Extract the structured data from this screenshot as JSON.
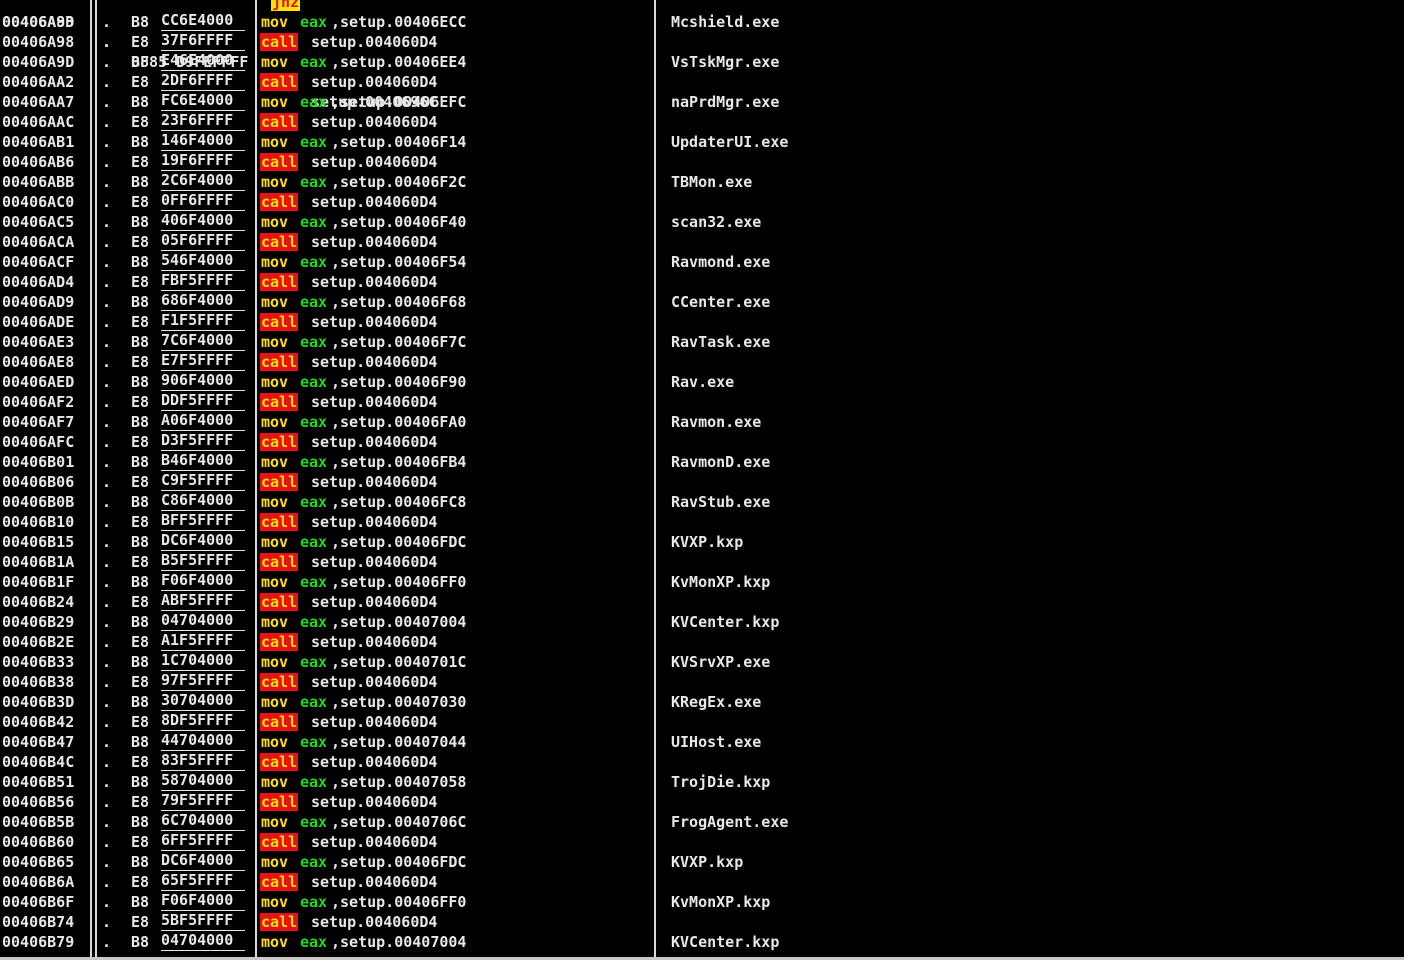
{
  "colors": {
    "background": "#000000",
    "text": "#e8e8e8",
    "call_bg": "#e8101a",
    "call_fg": "#ffe000",
    "mov_fg": "#ffe000",
    "register": "#20d820",
    "jump_bg": "#ffe000",
    "jump_fg": "#e8101a"
  },
  "top_partial_row": {
    "address": "00406A8D",
    "marker": ".",
    "opcode": "0F85 D9FEFFFF",
    "mnemonic": "jnz",
    "operand": "setup.0040696C"
  },
  "rows": [
    {
      "address": "00406A93",
      "marker": ".",
      "opcode": "B8",
      "imm": "CC6E4000",
      "mnemonic": "mov",
      "reg": "eax",
      "operand": ",setup.00406ECC",
      "comment": "Mcshield.exe"
    },
    {
      "address": "00406A98",
      "marker": ".",
      "opcode": "E8",
      "imm": "37F6FFFF",
      "mnemonic": "call",
      "operand": "setup.004060D4"
    },
    {
      "address": "00406A9D",
      "marker": ".",
      "opcode": "B8",
      "imm": "E46E4000",
      "mnemonic": "mov",
      "reg": "eax",
      "operand": ",setup.00406EE4",
      "comment": "VsTskMgr.exe"
    },
    {
      "address": "00406AA2",
      "marker": ".",
      "opcode": "E8",
      "imm": "2DF6FFFF",
      "mnemonic": "call",
      "operand": "setup.004060D4"
    },
    {
      "address": "00406AA7",
      "marker": ".",
      "opcode": "B8",
      "imm": "FC6E4000",
      "mnemonic": "mov",
      "reg": "eax",
      "operand": ",setup.00406EFC",
      "comment": "naPrdMgr.exe"
    },
    {
      "address": "00406AAC",
      "marker": ".",
      "opcode": "E8",
      "imm": "23F6FFFF",
      "mnemonic": "call",
      "operand": "setup.004060D4"
    },
    {
      "address": "00406AB1",
      "marker": ".",
      "opcode": "B8",
      "imm": "146F4000",
      "mnemonic": "mov",
      "reg": "eax",
      "operand": ",setup.00406F14",
      "comment": "UpdaterUI.exe"
    },
    {
      "address": "00406AB6",
      "marker": ".",
      "opcode": "E8",
      "imm": "19F6FFFF",
      "mnemonic": "call",
      "operand": "setup.004060D4"
    },
    {
      "address": "00406ABB",
      "marker": ".",
      "opcode": "B8",
      "imm": "2C6F4000",
      "mnemonic": "mov",
      "reg": "eax",
      "operand": ",setup.00406F2C",
      "comment": "TBMon.exe"
    },
    {
      "address": "00406AC0",
      "marker": ".",
      "opcode": "E8",
      "imm": "0FF6FFFF",
      "mnemonic": "call",
      "operand": "setup.004060D4"
    },
    {
      "address": "00406AC5",
      "marker": ".",
      "opcode": "B8",
      "imm": "406F4000",
      "mnemonic": "mov",
      "reg": "eax",
      "operand": ",setup.00406F40",
      "comment": "scan32.exe"
    },
    {
      "address": "00406ACA",
      "marker": ".",
      "opcode": "E8",
      "imm": "05F6FFFF",
      "mnemonic": "call",
      "operand": "setup.004060D4"
    },
    {
      "address": "00406ACF",
      "marker": ".",
      "opcode": "B8",
      "imm": "546F4000",
      "mnemonic": "mov",
      "reg": "eax",
      "operand": ",setup.00406F54",
      "comment": "Ravmond.exe"
    },
    {
      "address": "00406AD4",
      "marker": ".",
      "opcode": "E8",
      "imm": "FBF5FFFF",
      "mnemonic": "call",
      "operand": "setup.004060D4"
    },
    {
      "address": "00406AD9",
      "marker": ".",
      "opcode": "B8",
      "imm": "686F4000",
      "mnemonic": "mov",
      "reg": "eax",
      "operand": ",setup.00406F68",
      "comment": "CCenter.exe"
    },
    {
      "address": "00406ADE",
      "marker": ".",
      "opcode": "E8",
      "imm": "F1F5FFFF",
      "mnemonic": "call",
      "operand": "setup.004060D4"
    },
    {
      "address": "00406AE3",
      "marker": ".",
      "opcode": "B8",
      "imm": "7C6F4000",
      "mnemonic": "mov",
      "reg": "eax",
      "operand": ",setup.00406F7C",
      "comment": "RavTask.exe"
    },
    {
      "address": "00406AE8",
      "marker": ".",
      "opcode": "E8",
      "imm": "E7F5FFFF",
      "mnemonic": "call",
      "operand": "setup.004060D4"
    },
    {
      "address": "00406AED",
      "marker": ".",
      "opcode": "B8",
      "imm": "906F4000",
      "mnemonic": "mov",
      "reg": "eax",
      "operand": ",setup.00406F90",
      "comment": "Rav.exe"
    },
    {
      "address": "00406AF2",
      "marker": ".",
      "opcode": "E8",
      "imm": "DDF5FFFF",
      "mnemonic": "call",
      "operand": "setup.004060D4"
    },
    {
      "address": "00406AF7",
      "marker": ".",
      "opcode": "B8",
      "imm": "A06F4000",
      "mnemonic": "mov",
      "reg": "eax",
      "operand": ",setup.00406FA0",
      "comment": "Ravmon.exe"
    },
    {
      "address": "00406AFC",
      "marker": ".",
      "opcode": "E8",
      "imm": "D3F5FFFF",
      "mnemonic": "call",
      "operand": "setup.004060D4"
    },
    {
      "address": "00406B01",
      "marker": ".",
      "opcode": "B8",
      "imm": "B46F4000",
      "mnemonic": "mov",
      "reg": "eax",
      "operand": ",setup.00406FB4",
      "comment": "RavmonD.exe"
    },
    {
      "address": "00406B06",
      "marker": ".",
      "opcode": "E8",
      "imm": "C9F5FFFF",
      "mnemonic": "call",
      "operand": "setup.004060D4"
    },
    {
      "address": "00406B0B",
      "marker": ".",
      "opcode": "B8",
      "imm": "C86F4000",
      "mnemonic": "mov",
      "reg": "eax",
      "operand": ",setup.00406FC8",
      "comment": "RavStub.exe"
    },
    {
      "address": "00406B10",
      "marker": ".",
      "opcode": "E8",
      "imm": "BFF5FFFF",
      "mnemonic": "call",
      "operand": "setup.004060D4"
    },
    {
      "address": "00406B15",
      "marker": ".",
      "opcode": "B8",
      "imm": "DC6F4000",
      "mnemonic": "mov",
      "reg": "eax",
      "operand": ",setup.00406FDC",
      "comment": "KVXP.kxp"
    },
    {
      "address": "00406B1A",
      "marker": ".",
      "opcode": "E8",
      "imm": "B5F5FFFF",
      "mnemonic": "call",
      "operand": "setup.004060D4"
    },
    {
      "address": "00406B1F",
      "marker": ".",
      "opcode": "B8",
      "imm": "F06F4000",
      "mnemonic": "mov",
      "reg": "eax",
      "operand": ",setup.00406FF0",
      "comment": "KvMonXP.kxp"
    },
    {
      "address": "00406B24",
      "marker": ".",
      "opcode": "E8",
      "imm": "ABF5FFFF",
      "mnemonic": "call",
      "operand": "setup.004060D4"
    },
    {
      "address": "00406B29",
      "marker": ".",
      "opcode": "B8",
      "imm": "04704000",
      "mnemonic": "mov",
      "reg": "eax",
      "operand": ",setup.00407004",
      "comment": "KVCenter.kxp"
    },
    {
      "address": "00406B2E",
      "marker": ".",
      "opcode": "E8",
      "imm": "A1F5FFFF",
      "mnemonic": "call",
      "operand": "setup.004060D4"
    },
    {
      "address": "00406B33",
      "marker": ".",
      "opcode": "B8",
      "imm": "1C704000",
      "mnemonic": "mov",
      "reg": "eax",
      "operand": ",setup.0040701C",
      "comment": "KVSrvXP.exe"
    },
    {
      "address": "00406B38",
      "marker": ".",
      "opcode": "E8",
      "imm": "97F5FFFF",
      "mnemonic": "call",
      "operand": "setup.004060D4"
    },
    {
      "address": "00406B3D",
      "marker": ".",
      "opcode": "B8",
      "imm": "30704000",
      "mnemonic": "mov",
      "reg": "eax",
      "operand": ",setup.00407030",
      "comment": "KRegEx.exe"
    },
    {
      "address": "00406B42",
      "marker": ".",
      "opcode": "E8",
      "imm": "8DF5FFFF",
      "mnemonic": "call",
      "operand": "setup.004060D4"
    },
    {
      "address": "00406B47",
      "marker": ".",
      "opcode": "B8",
      "imm": "44704000",
      "mnemonic": "mov",
      "reg": "eax",
      "operand": ",setup.00407044",
      "comment": "UIHost.exe"
    },
    {
      "address": "00406B4C",
      "marker": ".",
      "opcode": "E8",
      "imm": "83F5FFFF",
      "mnemonic": "call",
      "operand": "setup.004060D4"
    },
    {
      "address": "00406B51",
      "marker": ".",
      "opcode": "B8",
      "imm": "58704000",
      "mnemonic": "mov",
      "reg": "eax",
      "operand": ",setup.00407058",
      "comment": "TrojDie.kxp"
    },
    {
      "address": "00406B56",
      "marker": ".",
      "opcode": "E8",
      "imm": "79F5FFFF",
      "mnemonic": "call",
      "operand": "setup.004060D4"
    },
    {
      "address": "00406B5B",
      "marker": ".",
      "opcode": "B8",
      "imm": "6C704000",
      "mnemonic": "mov",
      "reg": "eax",
      "operand": ",setup.0040706C",
      "comment": "FrogAgent.exe"
    },
    {
      "address": "00406B60",
      "marker": ".",
      "opcode": "E8",
      "imm": "6FF5FFFF",
      "mnemonic": "call",
      "operand": "setup.004060D4"
    },
    {
      "address": "00406B65",
      "marker": ".",
      "opcode": "B8",
      "imm": "DC6F4000",
      "mnemonic": "mov",
      "reg": "eax",
      "operand": ",setup.00406FDC",
      "comment": "KVXP.kxp"
    },
    {
      "address": "00406B6A",
      "marker": ".",
      "opcode": "E8",
      "imm": "65F5FFFF",
      "mnemonic": "call",
      "operand": "setup.004060D4"
    },
    {
      "address": "00406B6F",
      "marker": ".",
      "opcode": "B8",
      "imm": "F06F4000",
      "mnemonic": "mov",
      "reg": "eax",
      "operand": ",setup.00406FF0",
      "comment": "KvMonXP.kxp"
    },
    {
      "address": "00406B74",
      "marker": ".",
      "opcode": "E8",
      "imm": "5BF5FFFF",
      "mnemonic": "call",
      "operand": "setup.004060D4"
    },
    {
      "address": "00406B79",
      "marker": ".",
      "opcode": "B8",
      "imm": "04704000",
      "mnemonic": "mov",
      "reg": "eax",
      "operand": ",setup.00407004",
      "comment": "KVCenter.kxp"
    }
  ]
}
